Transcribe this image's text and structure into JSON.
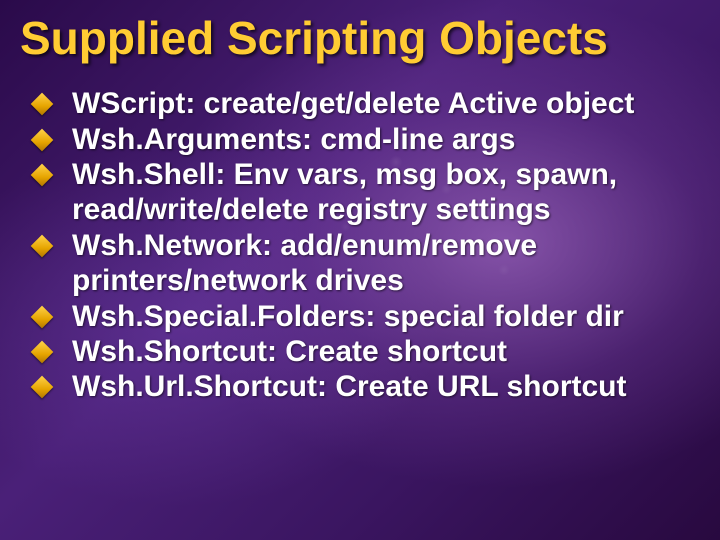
{
  "title": "Supplied Scripting Objects",
  "bullets": [
    {
      "text": "WScript:  create/get/delete Active object"
    },
    {
      "text": "Wsh.Arguments:  cmd-line args"
    },
    {
      "text": "Wsh.Shell:  Env vars, msg box, spawn, read/write/delete registry settings"
    },
    {
      "text": "Wsh.Network:  add/enum/remove printers/network drives"
    },
    {
      "text": "Wsh.Special.Folders:  special folder dir"
    },
    {
      "text": "Wsh.Shortcut:  Create shortcut"
    },
    {
      "text": "Wsh.Url.Shortcut:  Create URL shortcut"
    }
  ]
}
